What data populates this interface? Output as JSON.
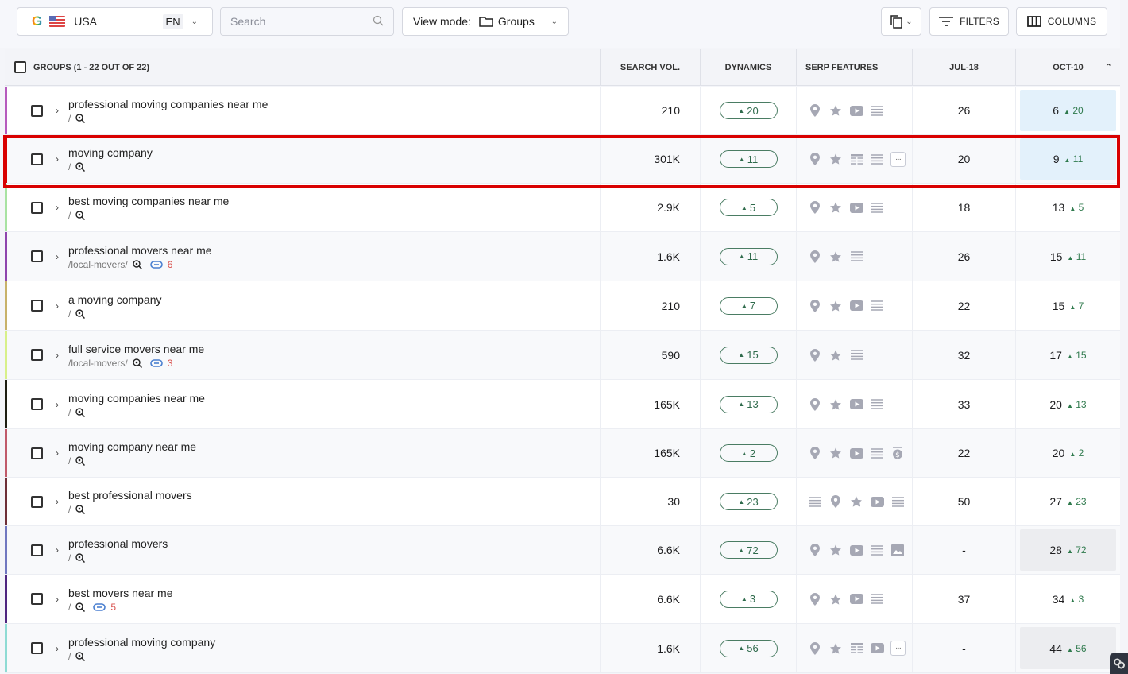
{
  "toolbar": {
    "search_engine": "G",
    "country": "USA",
    "language": "EN",
    "search_placeholder": "Search",
    "view_mode_label": "View mode:",
    "view_mode_value": "Groups",
    "filters_label": "FILTERS",
    "columns_label": "COLUMNS"
  },
  "table": {
    "header": {
      "groups": "GROUPS (1 - 22 OUT OF 22)",
      "search_vol": "SEARCH VOL.",
      "dynamics": "DYNAMICS",
      "serp_features": "SERP FEATURES",
      "jul": "JUL-18",
      "oct": "OCT-10"
    },
    "rows": [
      {
        "keyword": "professional moving companies near me",
        "url": "/",
        "links": null,
        "color": "#b65bbd",
        "volume": "210",
        "dynamics": "20",
        "serp": [
          "pin",
          "star",
          "video",
          "list"
        ],
        "jul": "26",
        "oct": "6",
        "oct_delta": "20",
        "oct_bg": "blue",
        "highlighted": false
      },
      {
        "keyword": "moving company",
        "url": "/",
        "links": null,
        "color": "#d90000",
        "volume": "301K",
        "dynamics": "11",
        "serp": [
          "pin",
          "star",
          "table",
          "list",
          "more"
        ],
        "jul": "20",
        "oct": "9",
        "oct_delta": "11",
        "oct_bg": "blue",
        "highlighted": true
      },
      {
        "keyword": "best moving companies near me",
        "url": "/",
        "links": null,
        "color": "#a8e2a2",
        "volume": "2.9K",
        "dynamics": "5",
        "serp": [
          "pin",
          "star",
          "video",
          "list"
        ],
        "jul": "18",
        "oct": "13",
        "oct_delta": "5",
        "oct_bg": "none",
        "highlighted": false
      },
      {
        "keyword": "professional movers near me",
        "url": "/local-movers/",
        "links": "6",
        "color": "#8e44ad",
        "volume": "1.6K",
        "dynamics": "11",
        "serp": [
          "pin",
          "star",
          "list"
        ],
        "jul": "26",
        "oct": "15",
        "oct_delta": "11",
        "oct_bg": "none",
        "highlighted": false
      },
      {
        "keyword": "a moving company",
        "url": "/",
        "links": null,
        "color": "#c8b26a",
        "volume": "210",
        "dynamics": "7",
        "serp": [
          "pin",
          "star",
          "video",
          "list"
        ],
        "jul": "22",
        "oct": "15",
        "oct_delta": "7",
        "oct_bg": "none",
        "highlighted": false
      },
      {
        "keyword": "full service movers near me",
        "url": "/local-movers/",
        "links": "3",
        "color": "#d8f08a",
        "volume": "590",
        "dynamics": "15",
        "serp": [
          "pin",
          "star",
          "list"
        ],
        "jul": "32",
        "oct": "17",
        "oct_delta": "15",
        "oct_bg": "none",
        "highlighted": false
      },
      {
        "keyword": "moving companies near me",
        "url": "/",
        "links": null,
        "color": "#1e1e12",
        "volume": "165K",
        "dynamics": "13",
        "serp": [
          "pin",
          "star",
          "video",
          "list"
        ],
        "jul": "33",
        "oct": "20",
        "oct_delta": "13",
        "oct_bg": "none",
        "highlighted": false
      },
      {
        "keyword": "moving company near me",
        "url": "/",
        "links": null,
        "color": "#c05a6a",
        "volume": "165K",
        "dynamics": "2",
        "serp": [
          "pin",
          "star",
          "video",
          "list",
          "dollar"
        ],
        "jul": "22",
        "oct": "20",
        "oct_delta": "2",
        "oct_bg": "none",
        "highlighted": false
      },
      {
        "keyword": "best professional movers",
        "url": "/",
        "links": null,
        "color": "#6e2f38",
        "volume": "30",
        "dynamics": "23",
        "serp": [
          "list",
          "pin",
          "star",
          "video",
          "list"
        ],
        "jul": "50",
        "oct": "27",
        "oct_delta": "23",
        "oct_bg": "none",
        "highlighted": false
      },
      {
        "keyword": "professional movers",
        "url": "/",
        "links": null,
        "color": "#7077c0",
        "volume": "6.6K",
        "dynamics": "72",
        "serp": [
          "pin",
          "star",
          "video",
          "list",
          "image"
        ],
        "jul": "-",
        "oct": "28",
        "oct_delta": "72",
        "oct_bg": "grey",
        "highlighted": false
      },
      {
        "keyword": "best movers near me",
        "url": "/",
        "links": "5",
        "color": "#4f2680",
        "volume": "6.6K",
        "dynamics": "3",
        "serp": [
          "pin",
          "star",
          "video",
          "list"
        ],
        "jul": "37",
        "oct": "34",
        "oct_delta": "3",
        "oct_bg": "none",
        "highlighted": false
      },
      {
        "keyword": "professional moving company",
        "url": "/",
        "links": null,
        "color": "#8edbd4",
        "volume": "1.6K",
        "dynamics": "56",
        "serp": [
          "pin",
          "star",
          "table",
          "video",
          "more"
        ],
        "jul": "-",
        "oct": "44",
        "oct_delta": "56",
        "oct_bg": "grey",
        "highlighted": false
      }
    ]
  }
}
